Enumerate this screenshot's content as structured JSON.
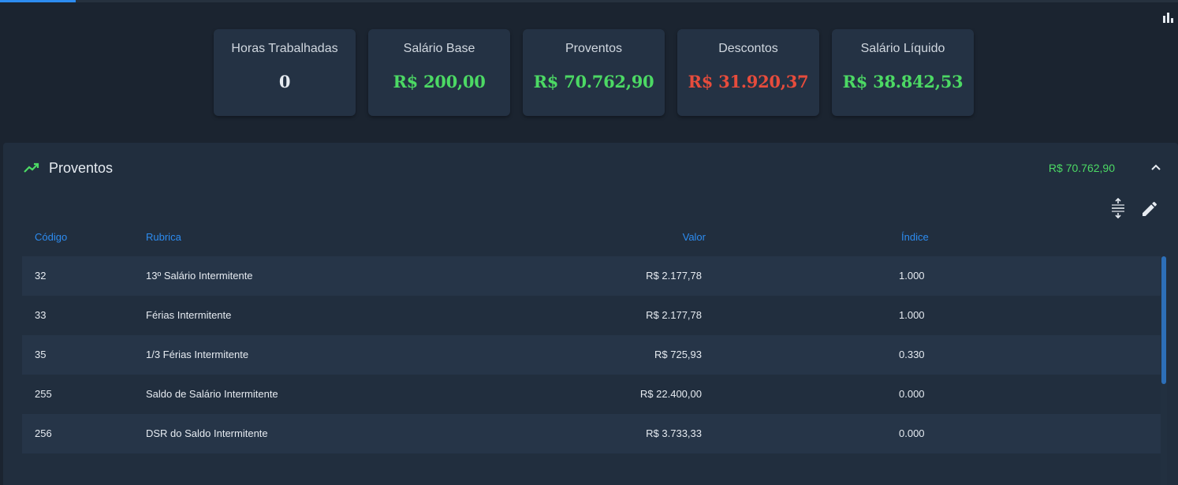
{
  "summary": [
    {
      "label": "Horas Trabalhadas",
      "value": "0",
      "color": "#e6ebf1"
    },
    {
      "label": "Salário Base",
      "value": "R$ 200,00",
      "color": "#4cd964"
    },
    {
      "label": "Proventos",
      "value": "R$ 70.762,90",
      "color": "#4cd964"
    },
    {
      "label": "Descontos",
      "value": "R$ 31.920,37",
      "color": "#e74c3c"
    },
    {
      "label": "Salário Líquido",
      "value": "R$ 38.842,53",
      "color": "#4cd964"
    }
  ],
  "panel": {
    "title": "Proventos",
    "total": "R$ 70.762,90",
    "icon": "trending-up-icon"
  },
  "table": {
    "columns": {
      "codigo": "Código",
      "rubrica": "Rubrica",
      "valor": "Valor",
      "indice": "Índice"
    },
    "rows": [
      {
        "codigo": "32",
        "rubrica": "13º Salário Intermitente",
        "valor": "R$ 2.177,78",
        "indice": "1.000"
      },
      {
        "codigo": "33",
        "rubrica": "Férias Intermitente",
        "valor": "R$ 2.177,78",
        "indice": "1.000"
      },
      {
        "codigo": "35",
        "rubrica": "1/3 Férias Intermitente",
        "valor": "R$ 725,93",
        "indice": "0.330"
      },
      {
        "codigo": "255",
        "rubrica": "Saldo de Salário Intermitente",
        "valor": "R$ 22.400,00",
        "indice": "0.000"
      },
      {
        "codigo": "256",
        "rubrica": "DSR do Saldo Intermitente",
        "valor": "R$ 3.733,33",
        "indice": "0.000"
      }
    ]
  },
  "colors": {
    "accent": "#2d8cf0",
    "positive": "#4cd964",
    "negative": "#e74c3c"
  }
}
